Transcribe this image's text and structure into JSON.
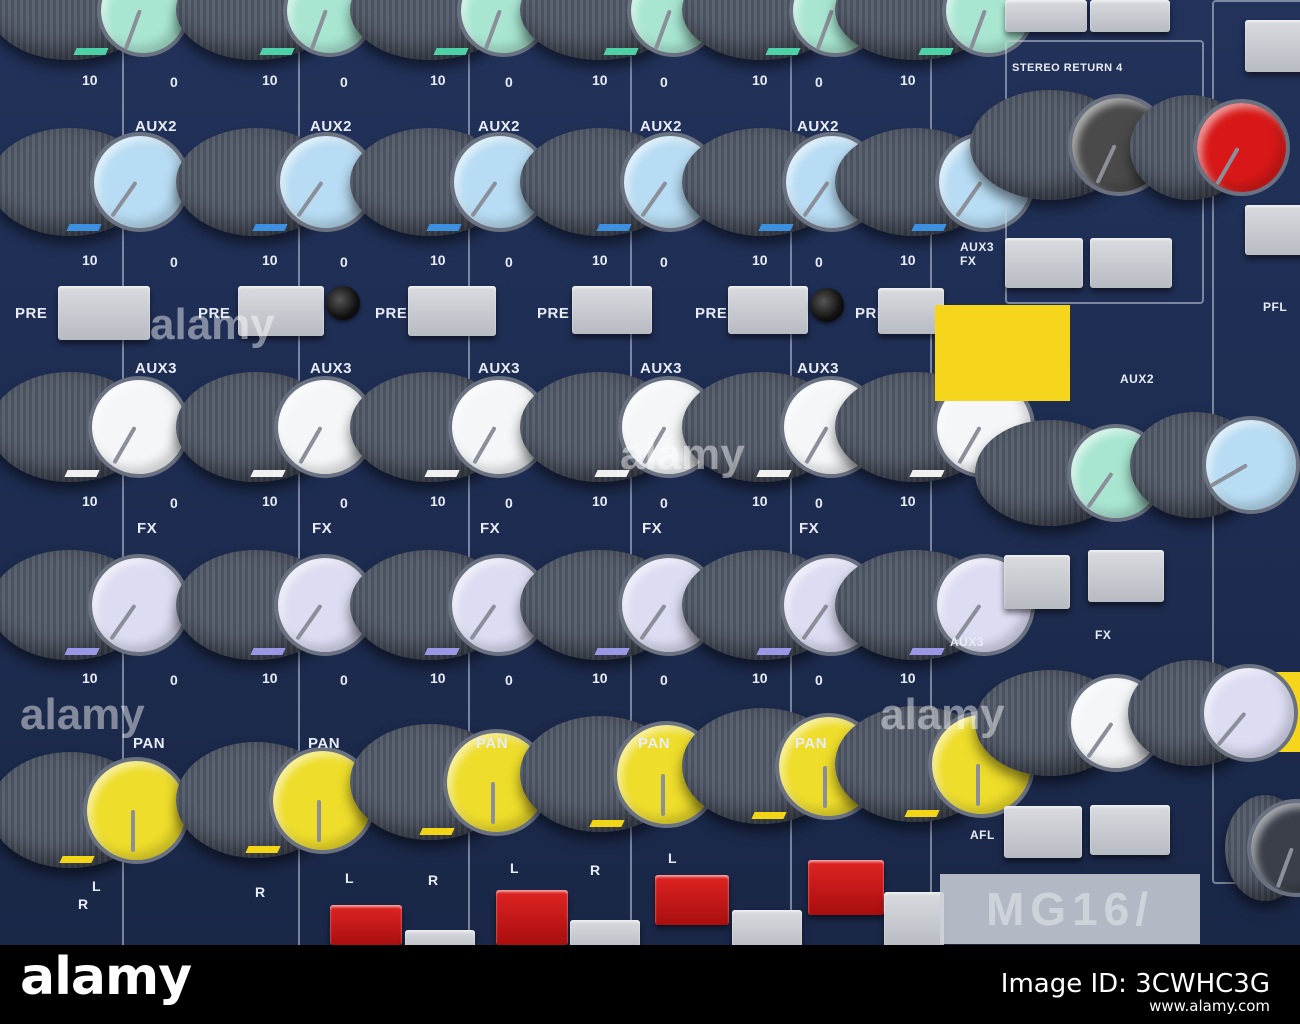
{
  "photo": {
    "subject": "audio mixing console",
    "panel_color": "#1e2d52",
    "knob_cap_colors": {
      "aux1": "#a8e6d2",
      "aux2": "#b7dcf3",
      "aux3": "#f4f6f8",
      "fx": "#dcdcf3",
      "pan": "#eedd2a",
      "stereo_return_dark": "#4a4a4a",
      "stereo_return_red": "#d81818"
    }
  },
  "strip": {
    "aux2_label": "AUX2",
    "aux3_label": "AUX3",
    "fx_label": "FX",
    "pan_label": "PAN",
    "pre_label": "PRE",
    "scale_min": "0",
    "scale_max": "10",
    "pan_left": "L",
    "pan_right": "R"
  },
  "master": {
    "stereo_return_label": "STEREO RETURN 4",
    "aux3_fx_label": "AUX3 FX",
    "afl_label": "AFL",
    "pfl_label": "PFL",
    "aux2_label": "AUX2",
    "fx_label": "FX",
    "aux3_label": "AUX3"
  },
  "brand": {
    "text": "MG16/"
  },
  "watermark": {
    "text": "alamy",
    "image_id": "Image ID: 3CWHC3G",
    "url": "www.alamy.com"
  },
  "icons": {
    "logo": "alamy-logo"
  }
}
